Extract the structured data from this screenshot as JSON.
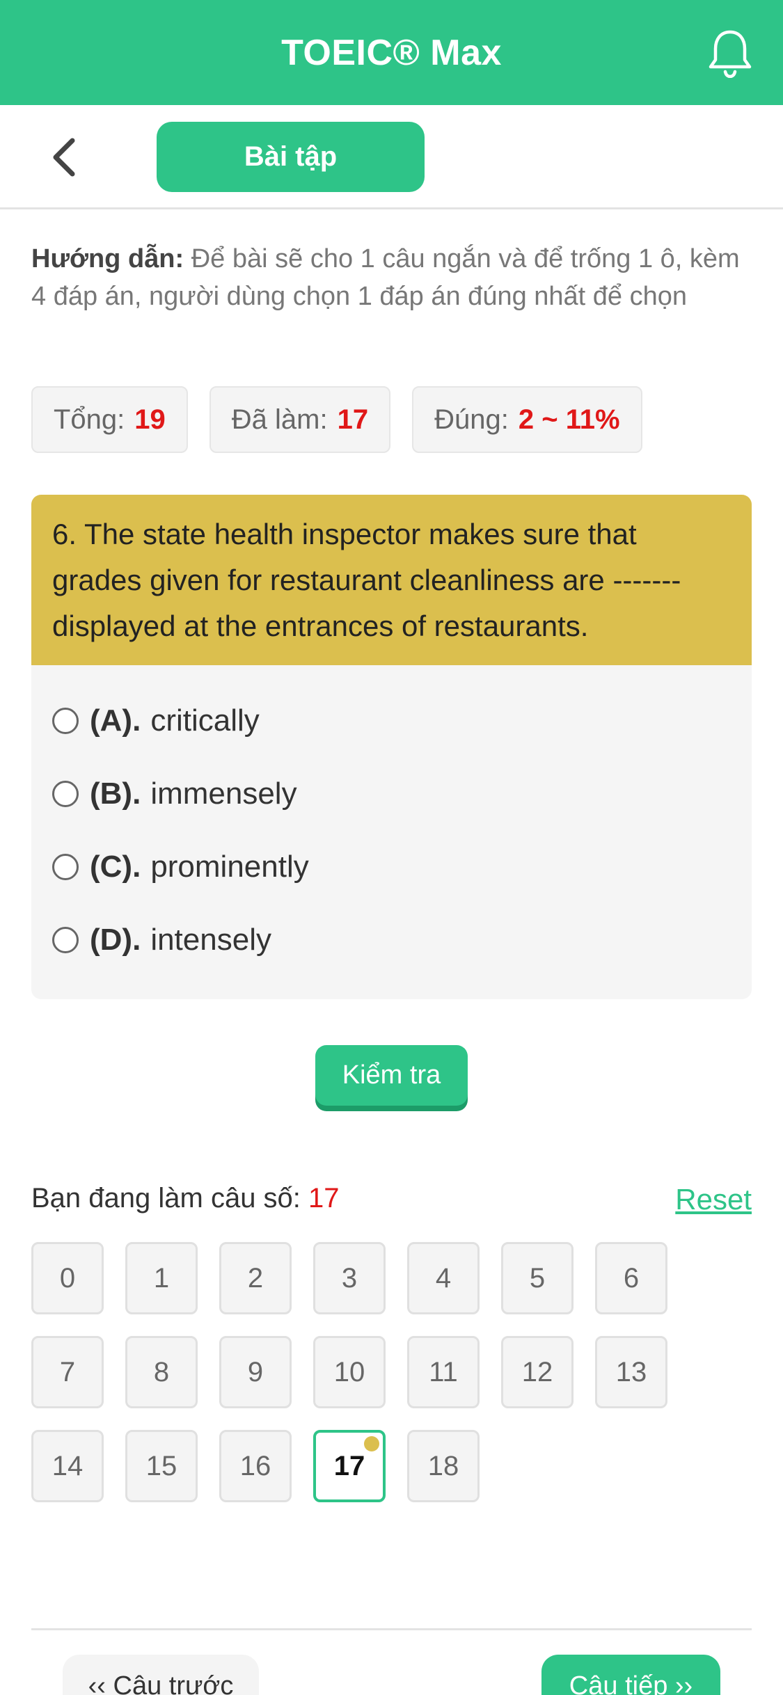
{
  "app": {
    "title": "TOEIC® Max"
  },
  "subheader": {
    "tab_label": "Bài tập"
  },
  "guide": {
    "label": "Hướng dẫn:",
    "text": "Để bài sẽ cho 1 câu ngắn và để trống 1 ô, kèm 4 đáp án, người dùng chọn 1 đáp án đúng nhất để chọn"
  },
  "stats": {
    "total_label": "Tổng:",
    "total_value": "19",
    "done_label": "Đã làm:",
    "done_value": "17",
    "correct_label": "Đúng:",
    "correct_value": "2 ~ 11%"
  },
  "question": {
    "text": "6. The state health inspector makes sure that grades given for restaurant cleanliness are ------- displayed at the entrances of restaurants.",
    "options": [
      {
        "key": "(A).",
        "text": "critically"
      },
      {
        "key": "(B).",
        "text": "immensely"
      },
      {
        "key": "(C).",
        "text": "prominently"
      },
      {
        "key": "(D).",
        "text": "intensely"
      }
    ]
  },
  "actions": {
    "check_label": "Kiểm tra"
  },
  "progress": {
    "label": "Bạn đang làm câu số:",
    "current": "17",
    "reset_label": "Reset",
    "numbers": [
      "0",
      "1",
      "2",
      "3",
      "4",
      "5",
      "6",
      "7",
      "8",
      "9",
      "10",
      "11",
      "12",
      "13",
      "14",
      "15",
      "16",
      "17",
      "18"
    ]
  },
  "footer": {
    "prev_label": "‹‹ Câu trước",
    "next_label": "Câu tiếp ››"
  },
  "colors": {
    "primary": "#2ec488",
    "question_bg": "#dbbf4e",
    "highlight": "#e01818"
  },
  "icons": {
    "notification": "bell-icon",
    "back": "chevron-left-icon"
  }
}
